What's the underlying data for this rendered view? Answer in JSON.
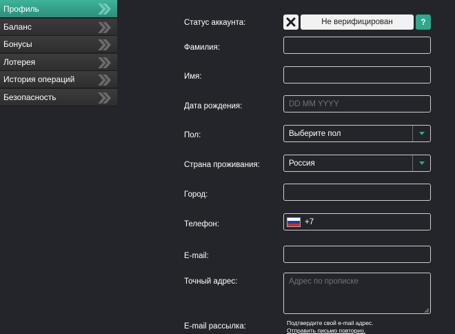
{
  "sidebar": {
    "items": [
      {
        "label": "Профиль",
        "active": true
      },
      {
        "label": "Баланс",
        "active": false
      },
      {
        "label": "Бонусы",
        "active": false
      },
      {
        "label": "Лотерея",
        "active": false
      },
      {
        "label": "История операций",
        "active": false
      },
      {
        "label": "Безопасность",
        "active": false
      }
    ]
  },
  "form": {
    "status_label": "Статус аккаунта:",
    "status_value": "Не верифицирован",
    "help_label": "?",
    "lastname_label": "Фамилия:",
    "lastname_value": "",
    "firstname_label": "Имя:",
    "firstname_value": "",
    "birthdate_label": "Дата рождения:",
    "birthdate_placeholder": "DD MM YYYY",
    "gender_label": "Пол:",
    "gender_value": "Выберите пол",
    "country_label": "Страна проживания:",
    "country_value": "Россия",
    "city_label": "Город:",
    "city_value": "",
    "phone_label": "Телефон:",
    "phone_value": "+7",
    "email_label": "E-mail:",
    "email_value": "",
    "address_label": "Точный адрес:",
    "address_placeholder": "Адрес по прописке",
    "newsletter_label": "E-mail рассылка:",
    "confirm_note": "Подтвердите свой e-mail адрес.",
    "resend_link": "Отправить письмо повторно."
  },
  "colors": {
    "accent": "#2fa88f",
    "background": "#23252a"
  }
}
